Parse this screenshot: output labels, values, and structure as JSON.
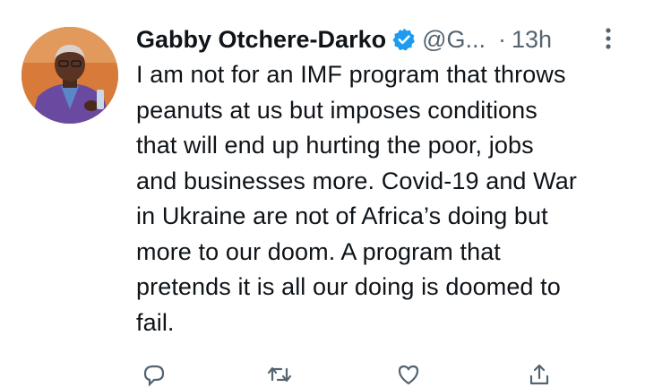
{
  "tweet": {
    "author_name": "Gabby Otchere-Darko",
    "handle": "@G...",
    "separator": "·",
    "time": "13h",
    "lines": [
      "I am not for an IMF program that throws",
      "peanuts at us but imposes conditions",
      "that will end up hurting the poor, jobs",
      "and businesses more. Covid-19 and War",
      "in Ukraine are not of Africa’s doing but",
      "more to our doom. A program that",
      "pretends it is all our doing is doomed to",
      "fail."
    ]
  },
  "icons": {
    "verified": "verified-badge-icon",
    "more": "more-vertical-icon",
    "reply": "reply-icon",
    "retweet": "retweet-icon",
    "like": "like-icon",
    "share": "share-icon"
  },
  "colors": {
    "verified_blue": "#1d9bf0",
    "secondary_text": "#536471",
    "primary_text": "#0f1419",
    "avatar_background": "#d87a3a"
  }
}
